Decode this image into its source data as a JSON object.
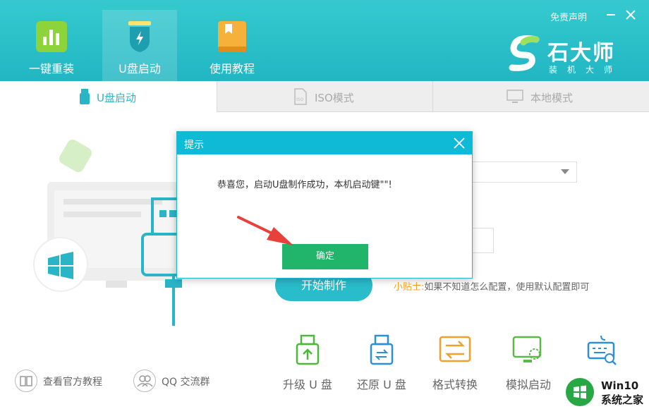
{
  "header": {
    "nav": [
      {
        "label": "一键重装",
        "icon": "bar-chart-icon"
      },
      {
        "label": "U盘启动",
        "icon": "usb-shield-icon"
      },
      {
        "label": "使用教程",
        "icon": "book-icon"
      }
    ],
    "disclaimer": "免责声明",
    "brand_name": "石大师",
    "brand_sub": "装机大师"
  },
  "tabs": [
    {
      "label": "U盘启动",
      "icon": "usb-icon"
    },
    {
      "label": "ISO模式",
      "icon": "iso-file-icon"
    },
    {
      "label": "本地模式",
      "icon": "monitor-icon"
    }
  ],
  "main": {
    "start_button": "开始制作",
    "tip_label": "小贴士:",
    "tip_text": "如果不知道怎么配置，使用默认配置即可"
  },
  "tools": [
    {
      "label": "升级 U 盘",
      "icon": "usb-upgrade-icon"
    },
    {
      "label": "还原 U 盘",
      "icon": "usb-restore-icon"
    },
    {
      "label": "格式转换",
      "icon": "format-convert-icon"
    },
    {
      "label": "模拟启动",
      "icon": "simulate-boot-icon"
    },
    {
      "label": "",
      "icon": "keyboard-search-icon"
    }
  ],
  "footer": {
    "tutorial": "查看官方教程",
    "qq_group": "QQ 交流群"
  },
  "dialog": {
    "title": "提示",
    "message": "恭喜您，启动U盘制作成功，本机启动键\"\"!",
    "ok": "确定"
  },
  "watermark": {
    "line1": "Win10",
    "line2": "系统之家"
  },
  "colors": {
    "header": "#2bbdc8",
    "accent": "#29b5c6",
    "ok_button": "#21b56b",
    "tip_label": "#f5a623",
    "dialog_head": "#0fbad6",
    "arrow": "#e8413b"
  }
}
